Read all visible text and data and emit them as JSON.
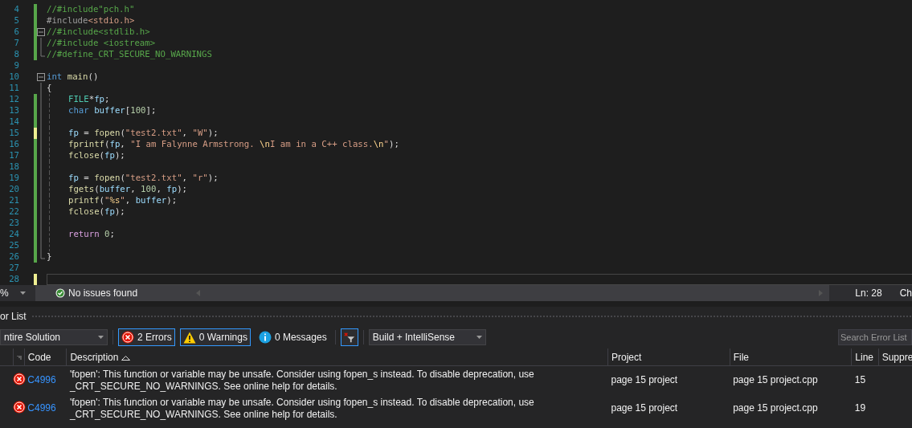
{
  "editor": {
    "lines": [
      {
        "number": "4",
        "modified": true,
        "saved": true,
        "tokens": [
          {
            "kind": "comment",
            "text": "//#include\"pch.h\""
          }
        ]
      },
      {
        "number": "5",
        "modified": true,
        "saved": true,
        "tokens": [
          {
            "kind": "preproc",
            "text": "#include"
          },
          {
            "kind": "string",
            "text": "<stdio.h>"
          }
        ]
      },
      {
        "number": "6",
        "modified": true,
        "saved": true,
        "tokens": [
          {
            "kind": "comment",
            "text": "//#include<stdlib.h>"
          }
        ],
        "children": [
          {
            "number": "7",
            "modified": true,
            "saved": true,
            "tokens": [
              {
                "kind": "comment",
                "text": "//#include <iostream>"
              }
            ]
          },
          {
            "number": "8",
            "modified": true,
            "saved": true,
            "tokens": [
              {
                "kind": "comment",
                "text": "//#define_CRT_SECURE_NO_WARNINGS"
              }
            ]
          }
        ]
      },
      {
        "number": "9",
        "modified": false
      },
      {
        "number": "10",
        "modified": false,
        "tokens": [
          {
            "kind": "keyword",
            "text": "int "
          },
          {
            "kind": "func",
            "text": "main"
          },
          {
            "kind": "plain",
            "text": "()"
          }
        ],
        "children": [
          {
            "number": "11",
            "modified": false,
            "tokens": [
              {
                "kind": "plain",
                "text": "{"
              }
            ]
          },
          {
            "number": "12",
            "modified": true,
            "saved": true,
            "indented": true,
            "tokens": [
              {
                "kind": "type",
                "text": "FILE"
              },
              {
                "kind": "plain",
                "text": "*"
              },
              {
                "kind": "var",
                "text": "fp"
              },
              {
                "kind": "plain",
                "text": ";"
              }
            ]
          },
          {
            "number": "13",
            "modified": true,
            "saved": true,
            "indented": true,
            "tokens": [
              {
                "kind": "keyword",
                "text": "char "
              },
              {
                "kind": "var",
                "text": "buffer"
              },
              {
                "kind": "plain",
                "text": "["
              },
              {
                "kind": "number",
                "text": "100"
              },
              {
                "kind": "plain",
                "text": "];"
              }
            ]
          },
          {
            "number": "14",
            "modified": true,
            "saved": true,
            "indented": true
          },
          {
            "number": "15",
            "modified": true,
            "saved": false,
            "indented": true,
            "tokens": [
              {
                "kind": "var",
                "text": "fp"
              },
              {
                "kind": "plain",
                "text": " = "
              },
              {
                "kind": "func",
                "text": "fopen"
              },
              {
                "kind": "plain",
                "text": "("
              },
              {
                "kind": "string",
                "text": "\"test2.txt\""
              },
              {
                "kind": "plain",
                "text": ", "
              },
              {
                "kind": "string",
                "text": "\"W\""
              },
              {
                "kind": "plain",
                "text": ");"
              }
            ]
          },
          {
            "number": "16",
            "modified": true,
            "saved": true,
            "indented": true,
            "tokens": [
              {
                "kind": "func",
                "text": "fprintf"
              },
              {
                "kind": "plain",
                "text": "("
              },
              {
                "kind": "var",
                "text": "fp"
              },
              {
                "kind": "plain",
                "text": ", "
              },
              {
                "kind": "string",
                "text": "\"I am Falynne Armstrong. "
              },
              {
                "kind": "escape",
                "text": "\\n"
              },
              {
                "kind": "string",
                "text": "I am in a C++ class."
              },
              {
                "kind": "escape",
                "text": "\\n"
              },
              {
                "kind": "string",
                "text": "\""
              },
              {
                "kind": "plain",
                "text": ");"
              }
            ]
          },
          {
            "number": "17",
            "modified": true,
            "saved": true,
            "indented": true,
            "tokens": [
              {
                "kind": "func",
                "text": "fclose"
              },
              {
                "kind": "plain",
                "text": "("
              },
              {
                "kind": "var",
                "text": "fp"
              },
              {
                "kind": "plain",
                "text": ");"
              }
            ]
          },
          {
            "number": "18",
            "modified": true,
            "saved": true,
            "indented": true
          },
          {
            "number": "19",
            "modified": true,
            "saved": true,
            "indented": true,
            "tokens": [
              {
                "kind": "var",
                "text": "fp"
              },
              {
                "kind": "plain",
                "text": " = "
              },
              {
                "kind": "func",
                "text": "fopen"
              },
              {
                "kind": "plain",
                "text": "("
              },
              {
                "kind": "string",
                "text": "\"test2.txt\""
              },
              {
                "kind": "plain",
                "text": ", "
              },
              {
                "kind": "string",
                "text": "\"r\""
              },
              {
                "kind": "plain",
                "text": ");"
              }
            ]
          },
          {
            "number": "20",
            "modified": true,
            "saved": true,
            "indented": true,
            "tokens": [
              {
                "kind": "func",
                "text": "fgets"
              },
              {
                "kind": "plain",
                "text": "("
              },
              {
                "kind": "var",
                "text": "buffer"
              },
              {
                "kind": "plain",
                "text": ", "
              },
              {
                "kind": "number",
                "text": "100"
              },
              {
                "kind": "plain",
                "text": ", "
              },
              {
                "kind": "var",
                "text": "fp"
              },
              {
                "kind": "plain",
                "text": ");"
              }
            ]
          },
          {
            "number": "21",
            "modified": true,
            "saved": true,
            "indented": true,
            "tokens": [
              {
                "kind": "func",
                "text": "printf"
              },
              {
                "kind": "plain",
                "text": "("
              },
              {
                "kind": "string",
                "text": "\""
              },
              {
                "kind": "escape",
                "text": "%s"
              },
              {
                "kind": "string",
                "text": "\""
              },
              {
                "kind": "plain",
                "text": ", "
              },
              {
                "kind": "var",
                "text": "buffer"
              },
              {
                "kind": "plain",
                "text": ");"
              }
            ]
          },
          {
            "number": "22",
            "modified": true,
            "saved": true,
            "indented": true,
            "tokens": [
              {
                "kind": "func",
                "text": "fclose"
              },
              {
                "kind": "plain",
                "text": "("
              },
              {
                "kind": "var",
                "text": "fp"
              },
              {
                "kind": "plain",
                "text": ");"
              }
            ]
          },
          {
            "number": "23",
            "modified": true,
            "saved": true,
            "indented": true
          },
          {
            "number": "24",
            "modified": true,
            "saved": true,
            "indented": true,
            "tokens": [
              {
                "kind": "control",
                "text": "return "
              },
              {
                "kind": "number",
                "text": "0"
              },
              {
                "kind": "plain",
                "text": ";"
              }
            ]
          },
          {
            "number": "25",
            "modified": true,
            "saved": true,
            "indented": true
          },
          {
            "number": "26",
            "modified": true,
            "saved": true,
            "tokens": [
              {
                "kind": "plain",
                "text": "}"
              }
            ]
          }
        ]
      },
      {
        "number": "27",
        "modified": false
      },
      {
        "number": "28",
        "modified": true,
        "saved": false,
        "selected": true
      }
    ]
  },
  "status_bar": {
    "zoom": "%",
    "issues": "No issues found",
    "line": "Ln: 28",
    "column": "Ch"
  },
  "error_list": {
    "title": "or List",
    "scope": "ntire Solution",
    "filters": [
      {
        "kind": "error",
        "label": "2 Errors",
        "selected": true
      },
      {
        "kind": "warning",
        "label": "0 Warnings",
        "selected": true
      },
      {
        "kind": "info",
        "label": "0 Messages",
        "selected": false
      }
    ],
    "source": "Build + IntelliSense",
    "search": {
      "placeholder": "Search Error List"
    },
    "columns": [
      "Code",
      "Description",
      "Project",
      "File",
      "Line",
      "Suppre"
    ],
    "rows": [
      {
        "code": "C4996",
        "description": "'fopen': This function or variable may be unsafe. Consider using fopen_s instead. To disable deprecation, use _CRT_SECURE_NO_WARNINGS. See online help for details.",
        "project": "page 15 project",
        "file": "page 15 project.cpp",
        "line": "15"
      },
      {
        "code": "C4996",
        "description": "'fopen': This function or variable may be unsafe. Consider using fopen_s instead. To disable deprecation, use _CRT_SECURE_NO_WARNINGS. See online help for details.",
        "project": "page 15 project",
        "file": "page 15 project.cpp",
        "line": "19"
      }
    ]
  }
}
